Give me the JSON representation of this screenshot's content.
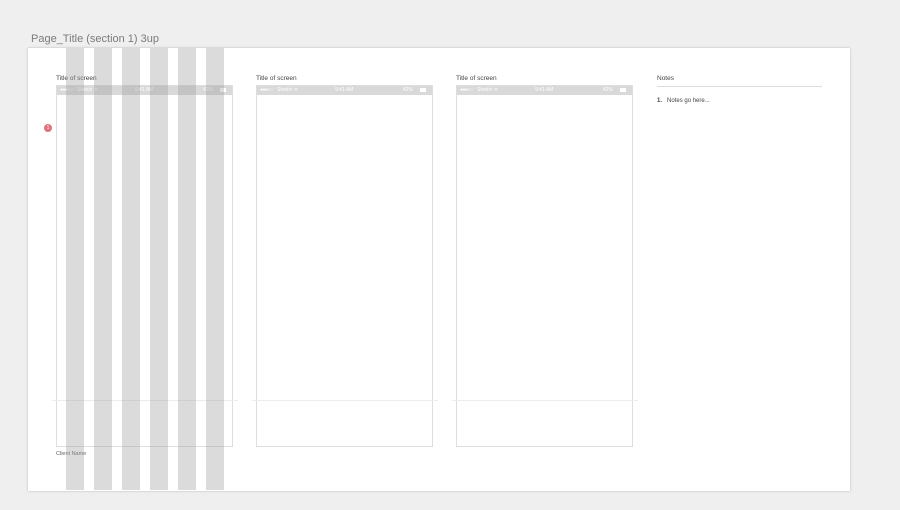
{
  "artboard": {
    "title": "Page_Title (section 1) 3up"
  },
  "screens": [
    {
      "title": "Title of screen",
      "status": {
        "signal": "●●●○○",
        "carrier": "Sketch ᯤ",
        "time": "9:41 AM",
        "battery_pct": "42%"
      }
    },
    {
      "title": "Title of screen",
      "status": {
        "signal": "●●●○○",
        "carrier": "Sketch ᯤ",
        "time": "9:41 AM",
        "battery_pct": "42%"
      }
    },
    {
      "title": "Title of screen",
      "status": {
        "signal": "●●●○○",
        "carrier": "Sketch ᯤ",
        "time": "9:41 AM",
        "battery_pct": "42%"
      }
    }
  ],
  "notes": {
    "title": "Notes",
    "items": [
      {
        "number": "1.",
        "text": "Notes go here..."
      }
    ]
  },
  "footer": {
    "client_name": "Client Name"
  },
  "hotspot": {
    "label": "1",
    "color": "#e0727a"
  },
  "grid_overlay": {
    "color": "#a0a0a0",
    "columns": 6
  }
}
